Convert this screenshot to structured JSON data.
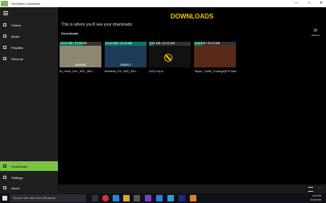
{
  "window": {
    "title": "OneVideo Universal",
    "minimize_icon": "—",
    "maximize_icon": "□",
    "close_icon": "✕"
  },
  "sidebar": {
    "items": [
      {
        "label": "Videos"
      },
      {
        "label": "Music"
      },
      {
        "label": "Playlists"
      },
      {
        "label": "Recents"
      }
    ],
    "bottom_items": [
      {
        "label": "Downloads",
        "active": true
      },
      {
        "label": "Settings"
      },
      {
        "label": "About"
      }
    ]
  },
  "main": {
    "heading": "DOWNLOADS",
    "subtitle": "This is where you'll see your downloads",
    "section_title": "Downloads",
    "refresh_label": "Refresh",
    "downloads": [
      {
        "size": "12.93 MB / 23.39 MB",
        "progress_fraction": 0.55,
        "speed": "2668006",
        "name": "ts_mine_hev_540_360...",
        "color": "#8c8672"
      },
      {
        "size": "24.44 MB / 24.45 MB",
        "progress_fraction": 1.0,
        "speed": "2668012",
        "name": "fearless_fhr_480_360...",
        "color": "#1e3c5a"
      },
      {
        "size": "0.01 MB / 42.42 MB",
        "progress_fraction": 0.1,
        "speed": "",
        "name": "2012.mp4",
        "color": "#111111"
      },
      {
        "size": "8.64 MB / 95.10 MB",
        "progress_fraction": 0.2,
        "speed": "",
        "name": "Taylor_Swift_Change(PD.mkv",
        "color": "#5a2a18"
      }
    ]
  },
  "taskbar": {
    "search_placeholder": "Search the web and Windows",
    "time": "2:53 PM",
    "date": "6/14/2018"
  }
}
